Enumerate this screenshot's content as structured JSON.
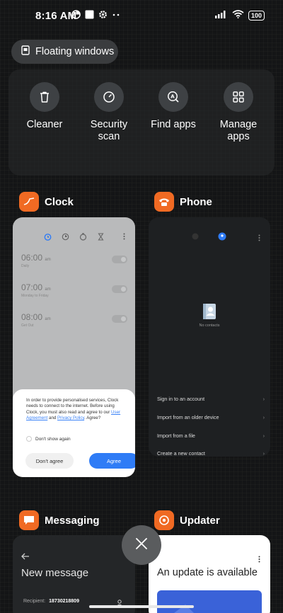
{
  "status_bar": {
    "time": "8:16 AM",
    "battery": "100",
    "icons_left": [
      "data-saver-icon",
      "notification-square-icon",
      "settings-gear-icon",
      "more-dots-icon"
    ],
    "icons_right": [
      "signal-icon",
      "wifi-icon",
      "battery-icon"
    ]
  },
  "floating_windows": {
    "label": "Floating windows",
    "icon": "floating-window-icon"
  },
  "quick_actions": [
    {
      "label": "Cleaner",
      "icon": "trash-icon"
    },
    {
      "label": "Security scan",
      "icon": "security-scan-icon"
    },
    {
      "label": "Find apps",
      "icon": "find-apps-icon"
    },
    {
      "label": "Manage apps",
      "icon": "grid-icon"
    }
  ],
  "recent_apps": {
    "clock": {
      "name": "Clock",
      "alarms": [
        {
          "time": "06:00",
          "ampm": "am",
          "label": "Daily"
        },
        {
          "time": "07:00",
          "ampm": "am",
          "label": "Monday to Friday"
        },
        {
          "time": "08:00",
          "ampm": "am",
          "label": "Get Out"
        }
      ],
      "dialog": {
        "text_1": "In order to provide personalised services, Clock needs to connect to the internet. Before using Clock, you must also read and agree to our ",
        "link_user_agreement": "User Agreement",
        "text_and": " and ",
        "link_privacy": "Privacy Policy",
        "text_end": ". Agree?",
        "dont_show": "Don't show again",
        "disagree": "Don't agree",
        "agree": "Agree"
      }
    },
    "phone": {
      "name": "Phone",
      "empty_text": "No contacts",
      "menu": [
        "Sign in to an account",
        "Import from an older device",
        "Import from a file",
        "Create a new contact"
      ]
    },
    "messaging": {
      "name": "Messaging",
      "title": "New message",
      "recipient_label": "Recipient:",
      "recipient_value": "18730218809"
    },
    "updater": {
      "name": "Updater",
      "title": "An update is available"
    }
  },
  "colors": {
    "app_icon_orange": "#f06a23",
    "accent_blue": "#2f7cf6",
    "background": "#141516"
  }
}
